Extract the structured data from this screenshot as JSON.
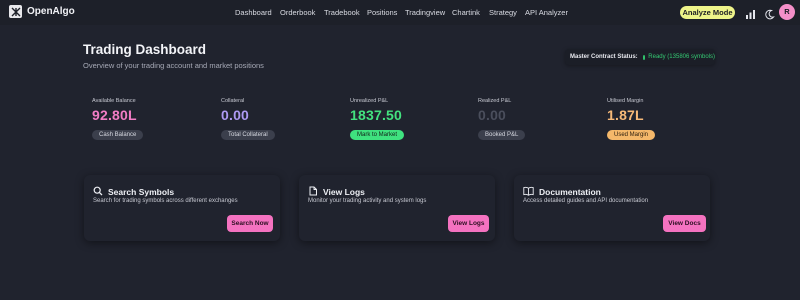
{
  "app": {
    "brand": "OpenAlgo"
  },
  "nav": {
    "items": [
      "Dashboard",
      "Orderbook",
      "Tradebook",
      "Positions",
      "Tradingview",
      "Chartink",
      "Strategy",
      "API Analyzer"
    ],
    "analyze_mode_label": "Analyze Mode",
    "avatar_initial": "R"
  },
  "header": {
    "title": "Trading Dashboard",
    "subtitle": "Overview of your trading account and market positions",
    "status_label": "Master Contract Status:",
    "status_value": "Ready (135806 symbols)"
  },
  "stats": [
    {
      "label": "Available Balance",
      "value": "92.80L",
      "badge": "Cash Balance",
      "color": "#f27dc6"
    },
    {
      "label": "Collateral",
      "value": "0.00",
      "badge": "Total Collateral",
      "color": "#ad99f2"
    },
    {
      "label": "Unrealized P&L",
      "value": "1837.50",
      "badge": "Mark to Market",
      "color": "#43e27f"
    },
    {
      "label": "Realized P&L",
      "value": "0.00",
      "badge": "Booked P&L",
      "color": "#4a4e5c"
    },
    {
      "label": "Utilised Margin",
      "value": "1.87L",
      "badge": "Used Margin",
      "color": "#f6b978"
    }
  ],
  "cards": [
    {
      "title": "Search Symbols",
      "desc": "Search for trading symbols across different exchanges",
      "button": "Search Now"
    },
    {
      "title": "View Logs",
      "desc": "Monitor your trading activity and system logs",
      "button": "View Logs"
    },
    {
      "title": "Documentation",
      "desc": "Access detailed guides and API documentation",
      "button": "View Docs"
    }
  ],
  "colors": {
    "background": "#20232e",
    "accent_pink": "#f472c0",
    "analyze_yellow": "#eef48a",
    "ready_green": "#34c972"
  }
}
